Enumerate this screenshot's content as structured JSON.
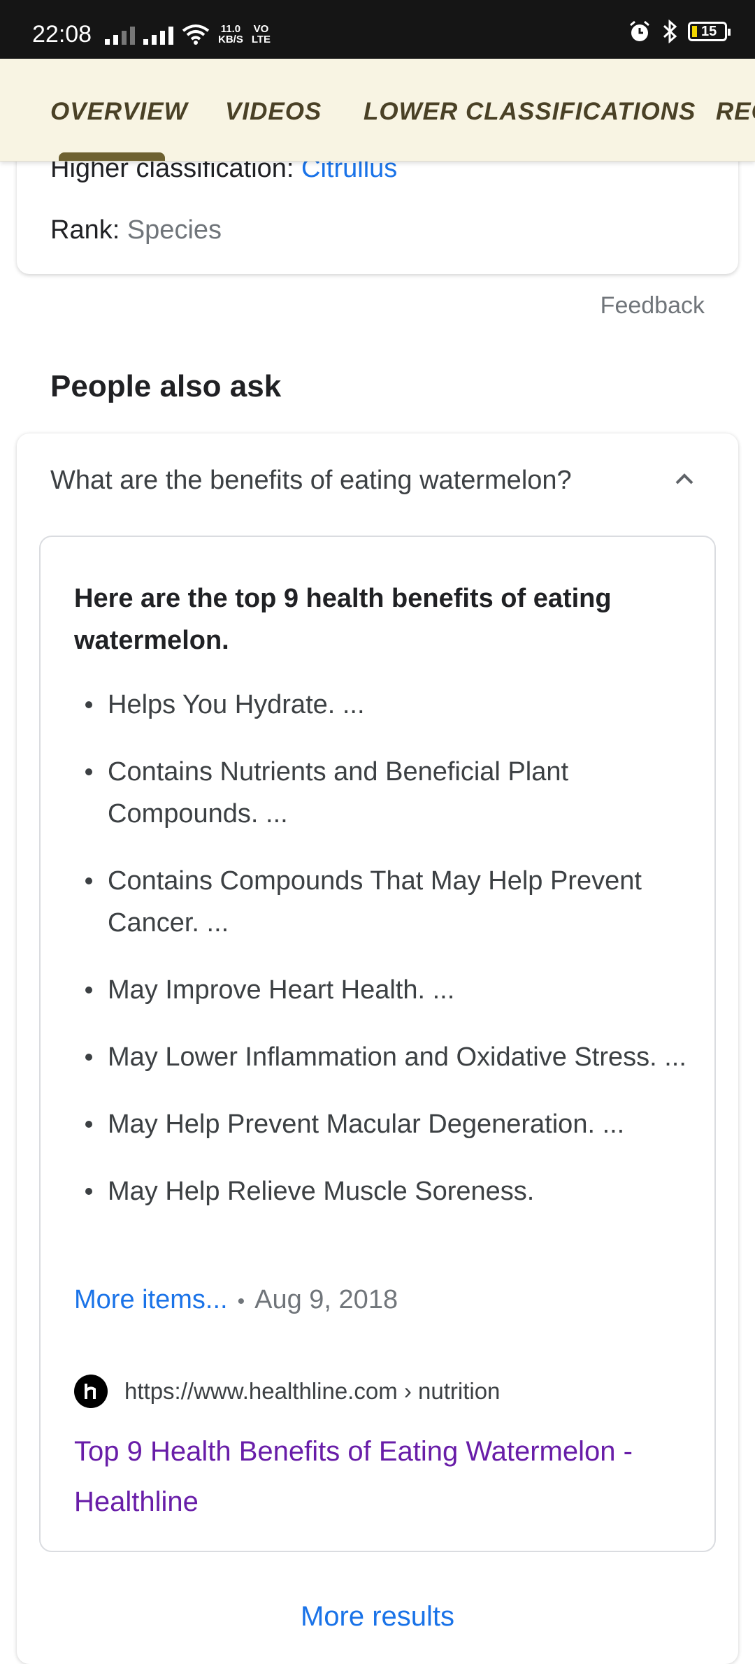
{
  "status_bar": {
    "time": "22:08",
    "net_speed": "11.0",
    "net_unit": "KB/S",
    "volte": "VO",
    "lte": "LTE",
    "battery": "15"
  },
  "tabs": [
    {
      "label": "OVERVIEW",
      "selected": true
    },
    {
      "label": "VIDEOS",
      "selected": false
    },
    {
      "label": "LOWER CLASSIFICATIONS",
      "selected": false
    },
    {
      "label": "REC",
      "selected": false
    }
  ],
  "classification": {
    "higher_label": "Higher classification: ",
    "higher_value": "Citrullus",
    "rank_label": "Rank: ",
    "rank_value": "Species"
  },
  "feedback": "Feedback",
  "people_also_ask": {
    "title": "People also ask",
    "question": "What are the benefits of eating watermelon?",
    "answer_heading": "Here are the top 9 health benefits of eating watermelon.",
    "items": [
      "Helps You Hydrate. ...",
      "Contains Nutrients and Beneficial Plant Compounds. ...",
      "Contains Compounds That May Help Prevent Cancer. ...",
      "May Improve Heart Health. ...",
      "May Lower Inflammation and Oxidative Stress. ...",
      "May Help Prevent Macular Degeneration. ...",
      "May Help Relieve Muscle Soreness."
    ],
    "more_items": "More items...",
    "separator": "•",
    "date": "Aug 9, 2018",
    "source_url": "https://www.healthline.com › nutrition",
    "result_title": "Top 9 Health Benefits of Eating Watermelon - Healthline",
    "more_results": "More results"
  },
  "colors": {
    "link": "#1a73e8",
    "visited_link": "#681da8",
    "tab_bar_bg": "#f8f4e3",
    "tab_text": "#4a4126",
    "tab_indicator": "#6e6131"
  }
}
